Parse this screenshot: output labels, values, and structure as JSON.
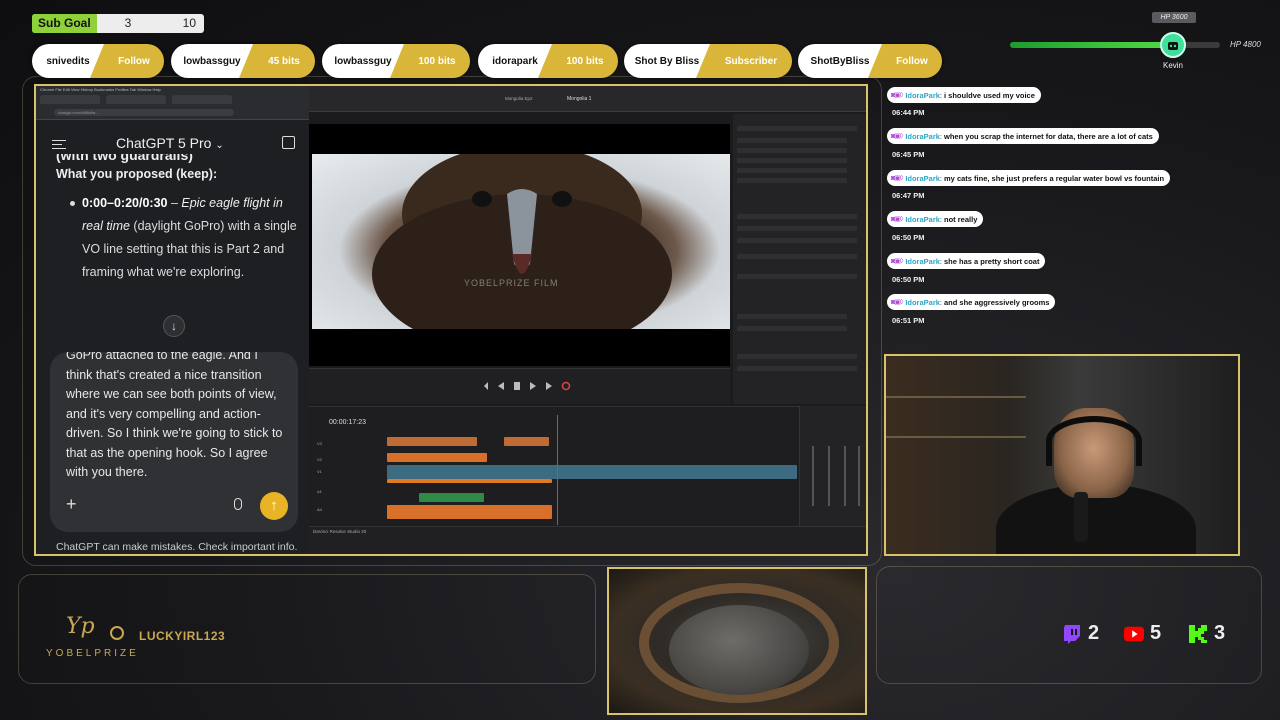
{
  "sub_goal": {
    "label": "Sub Goal",
    "current": "3",
    "target": "10"
  },
  "alerts": [
    {
      "name": "snivedits",
      "action": "Follow"
    },
    {
      "name": "lowbassguy",
      "action": "45 bits"
    },
    {
      "name": "lowbassguy",
      "action": "100 bits"
    },
    {
      "name": "idorapark",
      "action": "100 bits"
    },
    {
      "name": "Shot By Bliss",
      "action": "Subscriber"
    },
    {
      "name": "ShotByBliss",
      "action": "Follow"
    }
  ],
  "hp": {
    "current_label": "HP 3600",
    "max_label": "HP 4800",
    "fill_fraction": 0.75,
    "name": "Kevin"
  },
  "browser": {
    "menu": "Chrome  File  Edit  View  History  Bookmarks  Profiles  Tab  Window  Help",
    "url": "chatgpt.com/c/68b9a..."
  },
  "chatgpt": {
    "title": "ChatGPT 5 Pro",
    "cut_heading": "(with two guardrails)",
    "section": "What you proposed (keep):",
    "bullet_time": "0:00–0:20/0:30",
    "bullet_dash": " – ",
    "bullet_italic": "Epic eagle flight in real time",
    "bullet_rest": " (daylight GoPro) with a single VO line setting that this is Part 2 and framing what we're exploring.",
    "scroll_glyph": "↓",
    "composer_text": "GoPro attached to the eagle. And I think that's created a nice transition where we can see both points of view, and it's very compelling and action-driven. So I think we're going to stick to that as the opening hook. So I agree with you there.",
    "plus_glyph": "+",
    "send_glyph": "↑",
    "disclaimer": "ChatGPT can make mistakes. Check important info."
  },
  "resolve": {
    "project": "Mongolia 1",
    "timeline_name": "Mongolia Ep2",
    "timecode": "00:00:17:23",
    "watermark": "YOBELPRIZE FILM",
    "app_name": "DaVinci Resolve Studio 20"
  },
  "chat": [
    {
      "user": "IdoraPark",
      "text": "i shouldve used my voice",
      "time": "06:44 PM"
    },
    {
      "user": "IdoraPark",
      "text": "when you scrap the internet for data, there are a lot of cats",
      "time": "06:45 PM"
    },
    {
      "user": "IdoraPark",
      "text": "my cats fine, she just prefers a regular water bowl vs fountain",
      "time": "06:47 PM"
    },
    {
      "user": "IdoraPark",
      "text": "not really",
      "time": "06:50 PM"
    },
    {
      "user": "IdoraPark",
      "text": "she has a pretty short coat",
      "time": "06:50 PM"
    },
    {
      "user": "IdoraPark",
      "text": "and she aggressively grooms",
      "time": "06:51 PM"
    }
  ],
  "branding": {
    "logo_text": "YOBELPRIZE",
    "channel_name": "LUCKYIRL123"
  },
  "socials": [
    {
      "icon": "twitch-icon",
      "count": "2",
      "color": "#9146ff"
    },
    {
      "icon": "youtube-icon",
      "count": "5",
      "color": "#ff0000"
    },
    {
      "icon": "kick-icon",
      "count": "3",
      "color": "#53fc18"
    }
  ],
  "colors": {
    "accent_gold": "#d9c36a",
    "alert_gold": "#d9b63a",
    "goal_green": "#8fd13a",
    "send_button": "#e8b324"
  }
}
